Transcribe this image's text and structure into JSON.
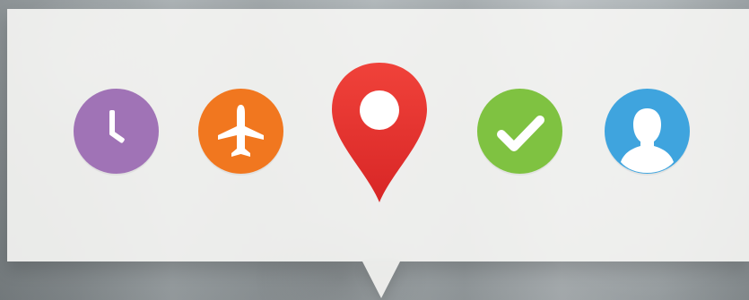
{
  "colors": {
    "clock": "#A073B6",
    "plane": "#F1771F",
    "location": "#E33730",
    "check": "#7FC241",
    "user": "#3FA4DE",
    "panel": "#F6F6F4"
  },
  "icons": [
    {
      "name": "clock-icon"
    },
    {
      "name": "airplane-icon"
    },
    {
      "name": "location-pin-icon"
    },
    {
      "name": "check-icon"
    },
    {
      "name": "user-icon"
    }
  ]
}
